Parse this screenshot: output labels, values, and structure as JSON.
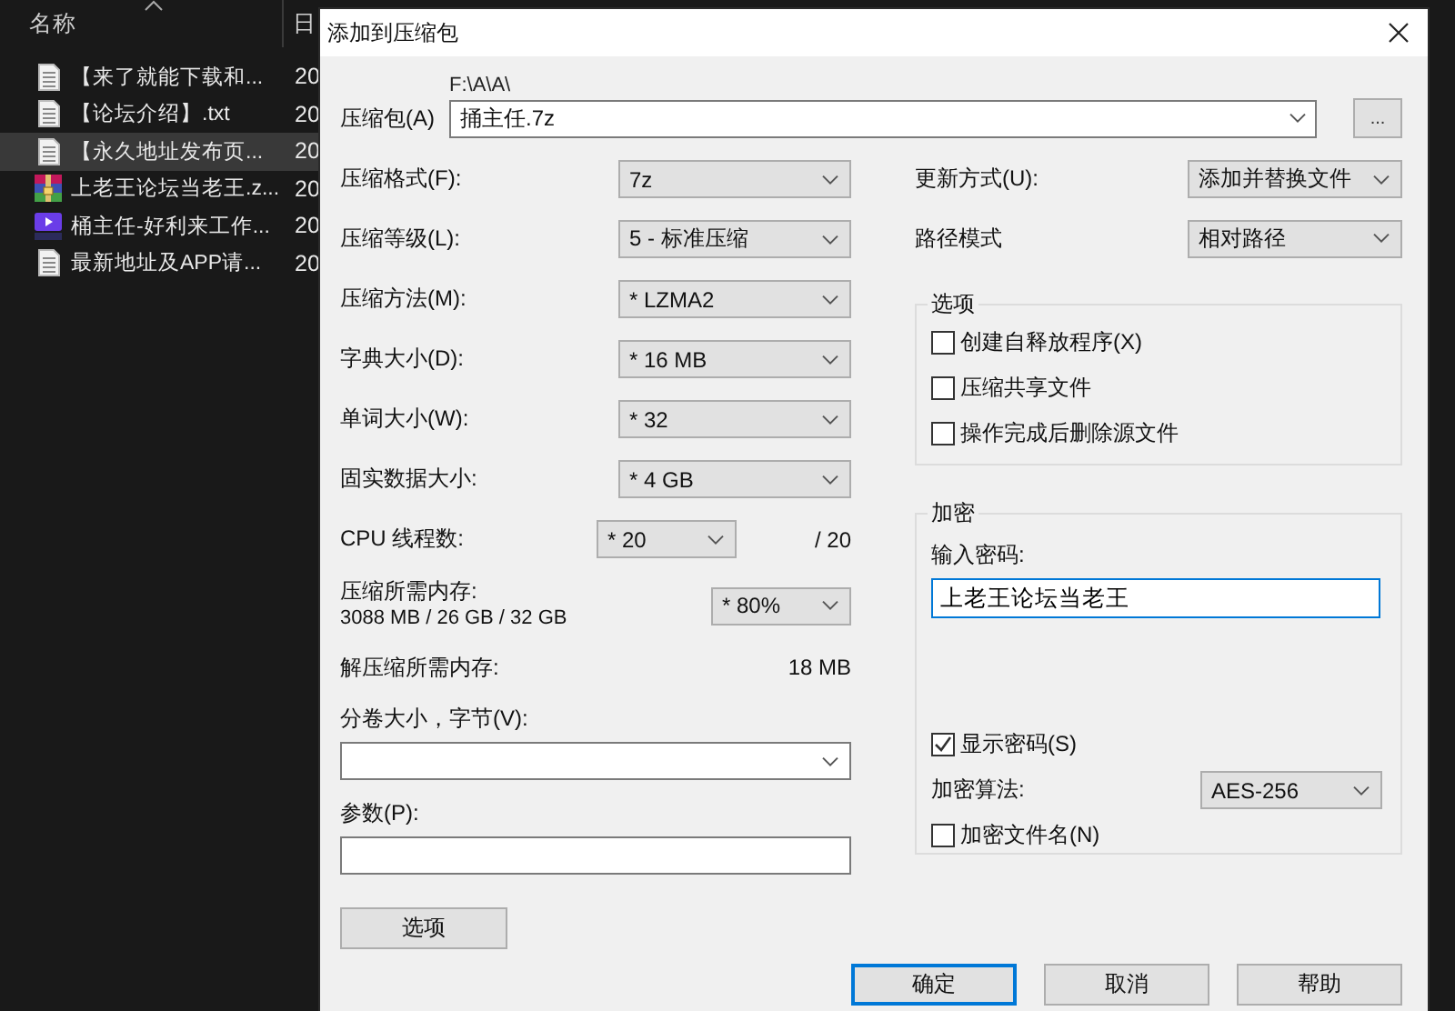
{
  "explorer": {
    "name_column": "名称",
    "date_column": "日",
    "files": [
      {
        "kind": "document",
        "name": "【来了就能下载和...",
        "date": "20",
        "selected": false
      },
      {
        "kind": "document",
        "name": "【论坛介绍】.txt",
        "date": "20",
        "selected": false
      },
      {
        "kind": "document",
        "name": "【永久地址发布页...",
        "date": "20",
        "selected": true
      },
      {
        "kind": "archive",
        "name": "上老王论坛当老王.z...",
        "date": "20",
        "selected": false
      },
      {
        "kind": "video",
        "name": "桶主任-好利来工作...",
        "date": "20",
        "selected": false
      },
      {
        "kind": "document",
        "name": "最新地址及APP请...",
        "date": "20",
        "selected": false
      }
    ]
  },
  "dialog": {
    "title": "添加到压缩包",
    "archive": {
      "label": "压缩包(A)",
      "folder": "F:\\A\\A\\",
      "value": "捅主任.7z",
      "browse_button": "..."
    },
    "settings": [
      {
        "kind": "select",
        "label": "压缩格式(F):",
        "value": "7z"
      },
      {
        "kind": "select",
        "label": "压缩等级(L):",
        "value": "5 - 标准压缩"
      },
      {
        "kind": "select",
        "label": "压缩方法(M):",
        "value": "* LZMA2"
      },
      {
        "kind": "select",
        "label": "字典大小(D):",
        "value": "* 16 MB"
      },
      {
        "kind": "select",
        "label": "单词大小(W):",
        "value": "* 32"
      },
      {
        "kind": "select",
        "label": "固实数据大小:",
        "value": "* 4 GB"
      },
      {
        "kind": "threads",
        "label": "CPU 线程数:",
        "value": "* 20",
        "total": "/ 20"
      },
      {
        "kind": "memory",
        "label": "压缩所需内存:",
        "detail": "3088 MB / 26 GB / 32 GB",
        "value": "* 80%"
      },
      {
        "kind": "info",
        "label": "解压缩所需内存:",
        "value": "18 MB"
      },
      {
        "kind": "combo",
        "label": "分卷大小，字节(V):"
      },
      {
        "kind": "input",
        "label": "参数(P):"
      }
    ],
    "update_mode": {
      "label": "更新方式(U):",
      "value": "添加并替换文件"
    },
    "path_mode": {
      "label": "路径模式",
      "value": "相对路径"
    },
    "options": {
      "title": "选项",
      "items": [
        {
          "label": "创建自释放程序(X)",
          "checked": false
        },
        {
          "label": "压缩共享文件",
          "checked": false
        },
        {
          "label": "操作完成后删除源文件",
          "checked": false
        }
      ]
    },
    "encryption": {
      "title": "加密",
      "password_label": "输入密码:",
      "password": "上老王论坛当老王",
      "show_password": {
        "label": "显示密码(S)",
        "checked": true
      },
      "method_label": "加密算法:",
      "method": "AES-256",
      "encrypt_names": {
        "label": "加密文件名(N)",
        "checked": false
      }
    },
    "options_button": "选项",
    "buttons": [
      {
        "label": "确定",
        "default": true
      },
      {
        "label": "取消",
        "default": false
      },
      {
        "label": "帮助",
        "default": false
      }
    ]
  }
}
